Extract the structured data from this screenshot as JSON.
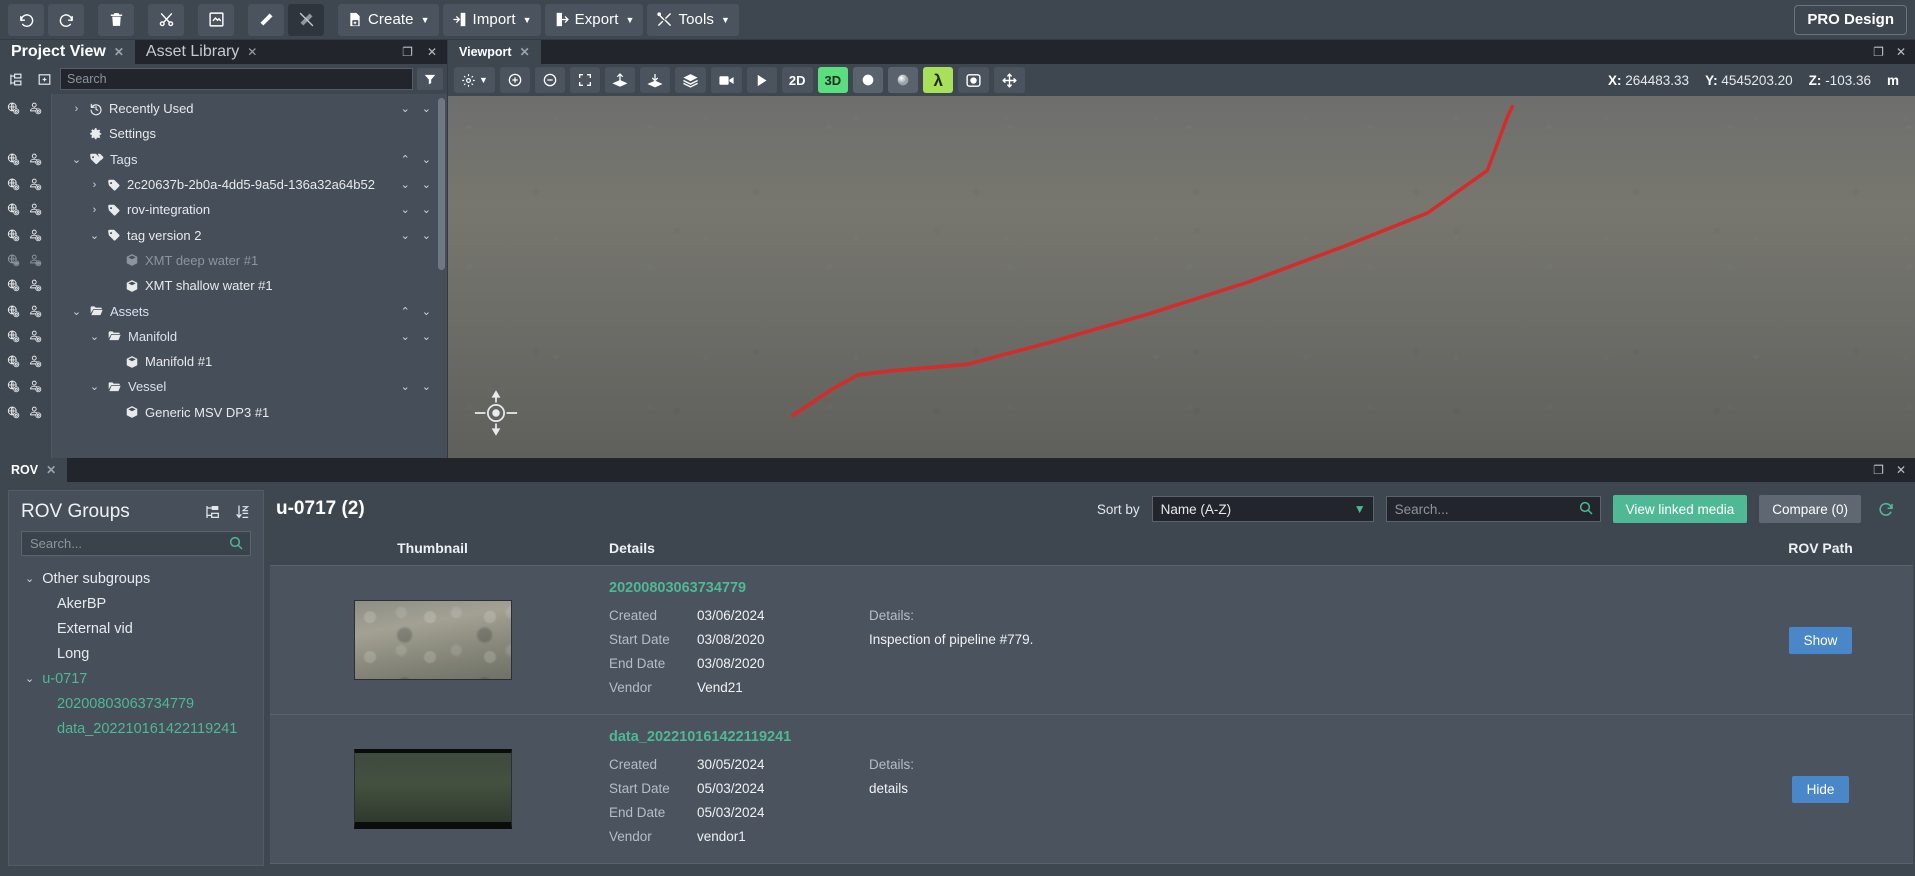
{
  "toolbar": {
    "buttons": [
      {
        "name": "undo",
        "icon": "undo-icon",
        "label": ""
      },
      {
        "name": "redo",
        "icon": "redo-icon",
        "label": ""
      },
      {
        "name": "delete",
        "icon": "trash-icon",
        "label": ""
      },
      {
        "name": "cut",
        "icon": "scissors-icon",
        "label": ""
      },
      {
        "name": "fit",
        "icon": "crop-frame-icon",
        "label": ""
      },
      {
        "name": "measure",
        "icon": "ruler-icon",
        "label": ""
      },
      {
        "name": "measure-off",
        "icon": "ruler-crossed-icon",
        "label": ""
      }
    ],
    "create_label": "Create",
    "import_label": "Import",
    "export_label": "Export",
    "tools_label": "Tools",
    "pro_design_label": "PRO Design"
  },
  "left_panel": {
    "tabs": [
      {
        "label": "Project View",
        "active": true
      },
      {
        "label": "Asset Library",
        "active": false
      }
    ],
    "search_placeholder": "Search",
    "search_value": "",
    "tree": [
      {
        "label": "Recently Used",
        "indent": 1,
        "chevron": "right",
        "icon": "history-icon",
        "dim": false,
        "type": "item",
        "gutter": true
      },
      {
        "label": "Settings",
        "indent": 1,
        "chevron": "none",
        "icon": "gear-icon",
        "dim": false,
        "type": "item",
        "gutter": false
      },
      {
        "label": "Tags",
        "indent": 1,
        "chevron": "down",
        "icon": "tags-icon",
        "dim": false,
        "type": "folder",
        "gutter": true
      },
      {
        "label": "2c20637b-2b0a-4dd5-9a5d-136a32a64b52",
        "indent": 2,
        "chevron": "right",
        "icon": "tag-icon",
        "dim": false,
        "type": "item",
        "gutter": true
      },
      {
        "label": "rov-integration",
        "indent": 2,
        "chevron": "right",
        "icon": "tag-icon",
        "dim": false,
        "type": "item",
        "gutter": true
      },
      {
        "label": "tag version 2",
        "indent": 2,
        "chevron": "down",
        "icon": "tag-icon",
        "dim": false,
        "type": "item",
        "gutter": true
      },
      {
        "label": "XMT deep water #1",
        "indent": 3,
        "chevron": "none",
        "icon": "box-icon",
        "dim": true,
        "type": "item",
        "gutter": true
      },
      {
        "label": "XMT shallow water #1",
        "indent": 3,
        "chevron": "none",
        "icon": "box-icon",
        "dim": false,
        "type": "item",
        "gutter": true
      },
      {
        "label": "Assets",
        "indent": 1,
        "chevron": "down",
        "icon": "folder-icon",
        "dim": false,
        "type": "folder",
        "gutter": true
      },
      {
        "label": "Manifold",
        "indent": 2,
        "chevron": "down",
        "icon": "folder-icon",
        "dim": false,
        "type": "folder",
        "gutter": true
      },
      {
        "label": "Manifold #1",
        "indent": 3,
        "chevron": "none",
        "icon": "box-icon",
        "dim": false,
        "type": "item",
        "gutter": true
      },
      {
        "label": "Vessel",
        "indent": 2,
        "chevron": "down",
        "icon": "folder-icon",
        "dim": false,
        "type": "folder",
        "gutter": true
      },
      {
        "label": "Generic MSV DP3 #1",
        "indent": 3,
        "chevron": "none",
        "icon": "box-icon",
        "dim": false,
        "type": "item",
        "gutter": true
      }
    ],
    "row_expanders": [
      "down",
      "none",
      "up",
      "down",
      "down",
      "down",
      "none",
      "none",
      "up",
      "down",
      "none",
      "down",
      "none"
    ]
  },
  "viewport": {
    "tabs": [
      {
        "label": "Viewport",
        "active": true
      }
    ],
    "toolbar": [
      {
        "name": "settings-gear",
        "icon": "gear-icon",
        "caret": true
      },
      {
        "name": "zoom-in",
        "icon": "zoom-in-icon"
      },
      {
        "name": "zoom-out",
        "icon": "zoom-out-icon"
      },
      {
        "name": "fit-screen",
        "icon": "expand-icon"
      },
      {
        "name": "upload-terrain",
        "icon": "upload-layers-icon"
      },
      {
        "name": "download-terrain",
        "icon": "download-layers-icon"
      },
      {
        "name": "layers",
        "icon": "layers-icon"
      },
      {
        "name": "record",
        "icon": "video-camera-icon"
      },
      {
        "name": "play",
        "icon": "play-icon"
      }
    ],
    "mode_2d": "2D",
    "mode_3d": "3D",
    "shading": [
      {
        "name": "sphere-solid",
        "icon": "sphere-icon",
        "active": false
      },
      {
        "name": "sphere-light",
        "icon": "sphere-lit-icon",
        "active": false
      },
      {
        "name": "lambda-tool",
        "icon": "lambda-icon",
        "active": true
      },
      {
        "name": "target-tool",
        "icon": "target-icon",
        "active": false
      },
      {
        "name": "move-tool",
        "icon": "move-arrows-icon",
        "active": false
      }
    ],
    "coordinates": {
      "x_label": "X:",
      "x_value": "264483.33",
      "y_label": "Y:",
      "y_value": "4545203.20",
      "z_label": "Z:",
      "z_value": "-103.36",
      "unit": "m"
    },
    "pipeline_color": "#d42b2b",
    "compass_name": "compass-rose-icon"
  },
  "rov": {
    "tabs": [
      {
        "label": "ROV",
        "active": true
      }
    ],
    "sidebar": {
      "title": "ROV Groups",
      "actions": [
        {
          "name": "tree-view-toggle",
          "icon": "tree-view-icon"
        },
        {
          "name": "sort-order-toggle",
          "icon": "sort-az-icon"
        }
      ],
      "search_placeholder": "Search...",
      "search_value": "",
      "groups": [
        {
          "label": "Other subgroups",
          "chevron": "down",
          "child": false,
          "accent": false
        },
        {
          "label": "AkerBP",
          "chevron": "none",
          "child": true,
          "accent": false
        },
        {
          "label": "External vid",
          "chevron": "none",
          "child": true,
          "accent": false
        },
        {
          "label": "Long",
          "chevron": "none",
          "child": true,
          "accent": false
        },
        {
          "label": "u-0717",
          "chevron": "down",
          "child": false,
          "accent": true
        },
        {
          "label": "20200803063734779",
          "chevron": "none",
          "child": true,
          "accent": true
        },
        {
          "label": "data_202210161422119241",
          "chevron": "none",
          "child": true,
          "accent": true
        }
      ]
    },
    "main": {
      "title": "u-0717 (2)",
      "sort_label": "Sort by",
      "sort_value": "Name (A-Z)",
      "sort_options": [
        "Name (A-Z)"
      ],
      "search_placeholder": "Search...",
      "search_value": "",
      "view_linked_media_label": "View linked media",
      "compare_label": "Compare (0)",
      "refresh_icon": "refresh-icon",
      "columns": {
        "thumbnail": "Thumbnail",
        "details": "Details",
        "rov_path": "ROV Path"
      },
      "rows": [
        {
          "title": "20200803063734779",
          "thumbnail_name": "seabed-thumbnail",
          "fields": [
            {
              "key": "Created",
              "value": "03/06/2024"
            },
            {
              "key": "Start Date",
              "value": "03/08/2020"
            },
            {
              "key": "End Date",
              "value": "03/08/2020"
            },
            {
              "key": "Vendor",
              "value": "Vend21"
            }
          ],
          "details_header": "Details:",
          "details_text": "Inspection of pipeline #779.",
          "action_label": "Show"
        },
        {
          "title": "data_202210161422119241",
          "thumbnail_name": "subsea-video-thumbnail",
          "fields": [
            {
              "key": "Created",
              "value": "30/05/2024"
            },
            {
              "key": "Start Date",
              "value": "05/03/2024"
            },
            {
              "key": "End Date",
              "value": "05/03/2024"
            },
            {
              "key": "Vendor",
              "value": "vendor1"
            }
          ],
          "details_header": "Details:",
          "details_text": "details",
          "action_label": "Hide"
        }
      ]
    }
  },
  "colors": {
    "accent_green": "#4fb894",
    "active_green": "#5ade7e",
    "lime": "#a8e05a",
    "blue_button": "#4a87c9",
    "panel_bg": "#3e4650",
    "tab_bg": "#22262c"
  }
}
